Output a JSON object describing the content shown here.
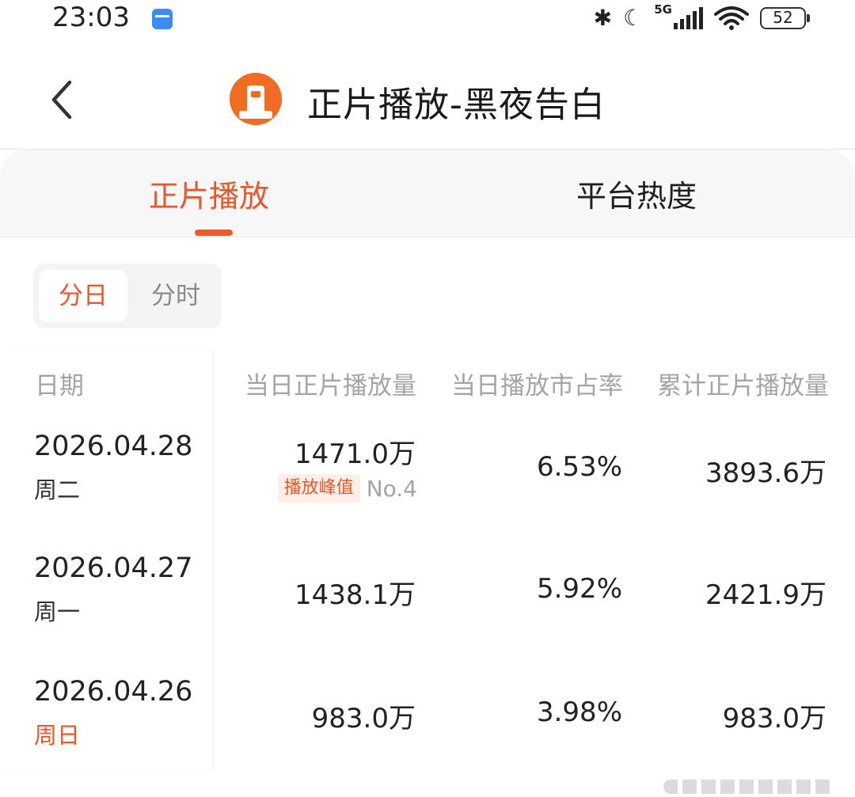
{
  "status_bar": {
    "time": "23:03",
    "network": "5G",
    "battery": "52"
  },
  "header": {
    "title": "正片播放-黑夜告白"
  },
  "tabs": [
    {
      "label": "正片播放",
      "active": true
    },
    {
      "label": "平台热度",
      "active": false
    }
  ],
  "segment": [
    {
      "label": "分日",
      "active": true
    },
    {
      "label": "分时",
      "active": false
    }
  ],
  "table": {
    "columns": [
      "日期",
      "当日正片播放量",
      "当日播放市占率",
      "累计正片播放量"
    ],
    "rows": [
      {
        "date": "2026.04.28",
        "weekday": "周二",
        "daily": "1471.0万",
        "share": "6.53%",
        "cumulative": "3893.6万",
        "badge": "播放峰值",
        "rank": "No.4"
      },
      {
        "date": "2026.04.27",
        "weekday": "周一",
        "daily": "1438.1万",
        "share": "5.92%",
        "cumulative": "2421.9万"
      },
      {
        "date": "2026.04.26",
        "weekday": "周日",
        "daily": "983.0万",
        "share": "3.98%",
        "cumulative": "983.0万"
      }
    ]
  },
  "colors": {
    "accent": "#e8562a",
    "logo": "#f26b22"
  }
}
